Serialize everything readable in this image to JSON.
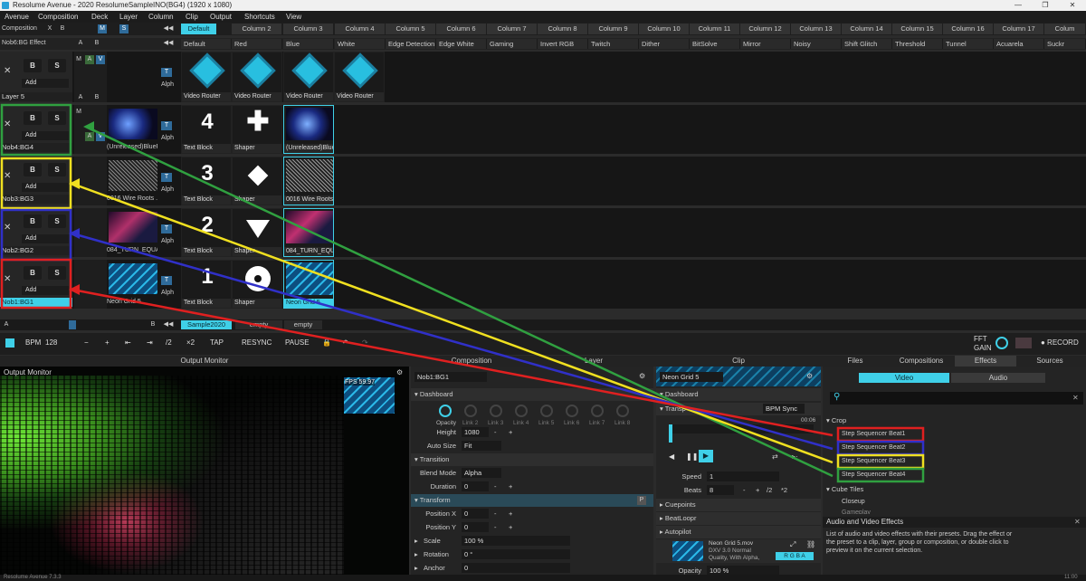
{
  "window": {
    "title": "Resolume Avenue - 2020 ResolumeSampleINO(BG4) (1920 x 1080)",
    "min": "—",
    "max": "❐",
    "close": "✕"
  },
  "menu": [
    "Avenue",
    "Composition",
    "Deck",
    "Layer",
    "Column",
    "Clip",
    "Output",
    "Shortcuts",
    "View"
  ],
  "comp": {
    "label": "Composition",
    "x": "X",
    "b": "B",
    "m": "M",
    "s": "S"
  },
  "columns": [
    "Default",
    "Column 2",
    "Column 3",
    "Column 4",
    "Column 5",
    "Column 6",
    "Column 7",
    "Column 8",
    "Column 9",
    "Column 10",
    "Column 11",
    "Column 12",
    "Column 13",
    "Column 14",
    "Column 15",
    "Column 16",
    "Column 17",
    "Colum"
  ],
  "fx_row": {
    "layer": "Nob6:BG Effect",
    "a": "A",
    "b": "B",
    "names": [
      "Default",
      "Red",
      "Blue",
      "White",
      "Edge Detection",
      "Edge White",
      "Gaming",
      "Invert RGB",
      "Twitch",
      "Dither",
      "BitSolve",
      "Mirror",
      "Noisy",
      "Shift Glitch",
      "Threshold",
      "Tunnel",
      "Acuarela",
      "Suckr"
    ]
  },
  "layers": [
    {
      "name": "Layer 5",
      "clips": [
        "Video Router",
        "Video Router",
        "Video Router",
        "Video Router"
      ]
    },
    {
      "name": "Nob4:BG4",
      "clips": [
        "(Unreleased)BlueF...",
        "Text Block",
        "Shaper",
        "(Unreleased)BlueF..."
      ],
      "num": "4"
    },
    {
      "name": "Nob3:BG3",
      "clips": [
        "0016 Wire Roots ...",
        "Text Block",
        "Shaper",
        "0016 Wire Roots ..."
      ],
      "num": "3"
    },
    {
      "name": "Nob2:BG2",
      "clips": [
        "084_TURN_EQUAL...",
        "Text Block",
        "Shaper",
        "084_TURN_EQUAL..."
      ],
      "num": "2"
    },
    {
      "name": "Nob1:BG1",
      "clips": [
        "Neon Grid 5",
        "Text Block",
        "Shaper",
        "Neon Grid 5"
      ],
      "num": "1"
    }
  ],
  "layer_ui": {
    "x": "✕",
    "b": "B",
    "s": "S",
    "add": "Add",
    "t": "T",
    "alph": "Alph",
    "m": "M",
    "a": "A",
    "bb": "B",
    "v": "V"
  },
  "decks": {
    "a": "A",
    "b": "B",
    "tabs": [
      "Sample2020",
      "empty",
      "empty"
    ]
  },
  "transport": {
    "bpm_label": "BPM",
    "bpm": "128",
    "minus": "−",
    "plus": "+",
    "prev": "⇤",
    "next": "⇥",
    "div2": "/2",
    "x2": "×2",
    "tap": "TAP",
    "resync": "RESYNC",
    "pause": "PAUSE",
    "fft": "FFT",
    "gain": "GAIN",
    "record": "● RECORD"
  },
  "panels": {
    "output_monitor": "Output Monitor",
    "composition": "Composition",
    "layer": "Layer",
    "clip": "Clip",
    "files": "Files",
    "compositions": "Compositions",
    "effects": "Effects",
    "sources": "Sources"
  },
  "outmon": {
    "title": "Output Monitor",
    "fps": "FPS 59.97"
  },
  "layerpanel": {
    "name": "Nob1:BG1",
    "dashboard": "Dashboard",
    "opacity": "Opacity",
    "links": [
      "Link 2",
      "Link 3",
      "Link 4",
      "Link 5",
      "Link 6",
      "Link 7",
      "Link 8"
    ],
    "height_label": "Height",
    "height_val": "1080",
    "autosize_label": "Auto Size",
    "autosize_val": "Fit",
    "transition": "Transition",
    "blend_label": "Blend Mode",
    "blend_val": "Alpha",
    "duration_label": "Duration",
    "duration_val": "0",
    "transform": "Transform",
    "posx_label": "Position X",
    "posx_val": "0",
    "posy_label": "Position Y",
    "posy_val": "0",
    "scale_label": "Scale",
    "scale_val": "100 %",
    "rotation_label": "Rotation",
    "rotation_val": "0 °",
    "anchor_label": "Anchor",
    "anchor_val": "0",
    "minus": "-",
    "plus": "+",
    "p": "P"
  },
  "clippanel": {
    "name": "Neon Grid 5",
    "dashboard": "Dashboard",
    "transport": "Transp",
    "bpmsync": "BPM Sync",
    "time": "00:06",
    "speed_label": "Speed",
    "speed_val": "1",
    "beats_label": "Beats",
    "beats_val": "8",
    "div2": "/2",
    "x2": "*2",
    "minus": "-",
    "plus": "+",
    "cuepoints": "Cuepoints",
    "beatloopr": "BeatLoopr",
    "autopilot": "Autopilot",
    "file": "Neon Grid 5.mov",
    "codec": "DXV 3.0 Normal",
    "quality": "Quality, With Alpha,",
    "rgba": "R G B A",
    "opacity_label": "Opacity",
    "opacity_val": "100 %"
  },
  "browser": {
    "video": "Video",
    "audio": "Audio",
    "search_icon": "search-icon",
    "crop": "Crop",
    "items": [
      "Step Sequencer Beat1",
      "Step Sequencer Beat2",
      "Step Sequencer Beat3",
      "Step Sequencer Beat4"
    ],
    "cube": "Cube Tiles",
    "closeup": "Closeup",
    "gameplay": "Gameplay",
    "help_title": "Audio and Video Effects",
    "help_text": "List of audio and video effects with their presets. Drag the effect or the preset to a clip, layer, group or composition, or double click to preview it on the current selection."
  },
  "colors": {
    "accent": "#3fd0e8",
    "red": "#e02020",
    "blue": "#3030c8",
    "yellow": "#f0e020",
    "green": "#30a040"
  },
  "status": {
    "left": "Resolume Avenue 7.3.3",
    "right": "11:00"
  }
}
